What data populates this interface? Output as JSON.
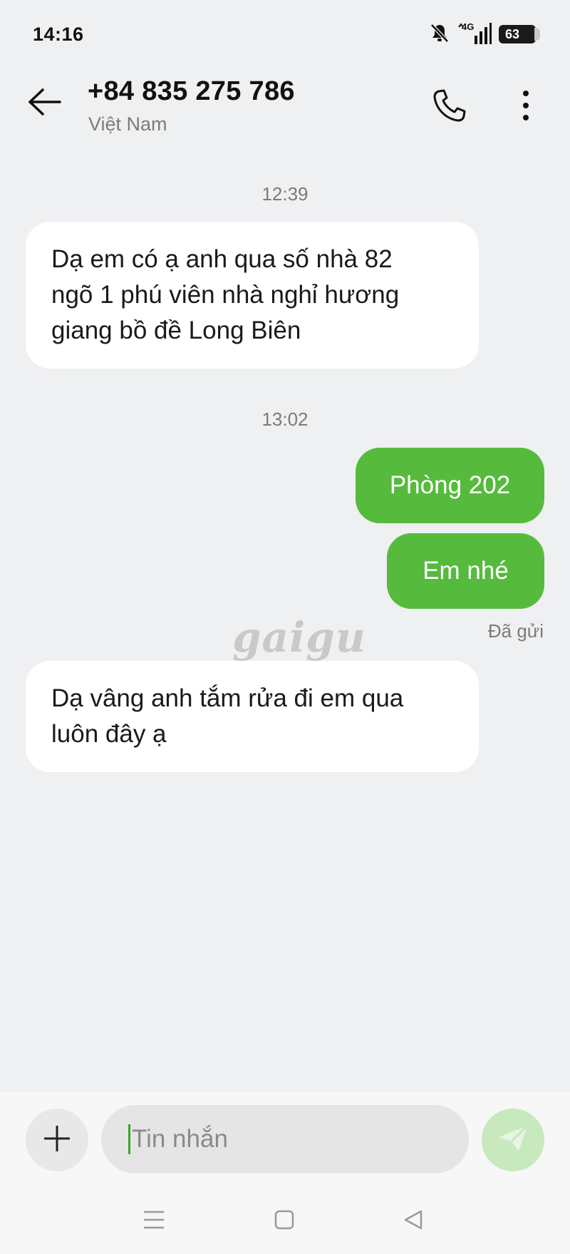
{
  "status_bar": {
    "time": "14:16",
    "network": "4G",
    "battery": "63",
    "icons": [
      "bell-muted-icon",
      "signal-4g-icon",
      "battery-icon"
    ]
  },
  "header": {
    "title": "+84 835 275 786",
    "subtitle": "Việt Nam",
    "icons": [
      "back-arrow-icon",
      "phone-icon",
      "more-vertical-icon"
    ]
  },
  "conversation": {
    "groups": [
      {
        "time": "12:39",
        "messages": [
          {
            "direction": "incoming",
            "lines": [
              "Dạ em có ạ anh qua số nhà 82",
              "ngõ 1 phú viên nhà nghỉ hương",
              "giang bồ đề Long Biên"
            ]
          }
        ]
      },
      {
        "time": "13:02",
        "messages": [
          {
            "direction": "outgoing",
            "text": "Phòng 202"
          },
          {
            "direction": "outgoing",
            "text": "Em nhé",
            "status": "Đã gửi"
          },
          {
            "direction": "incoming",
            "lines": [
              "Dạ vâng anh tắm rửa đi em qua",
              "luôn đây ạ"
            ]
          }
        ]
      }
    ]
  },
  "watermark": "gaigu",
  "composer": {
    "placeholder": "Tin nhắn",
    "value": "",
    "icons": [
      "plus-icon",
      "send-icon"
    ]
  },
  "nav_bar": {
    "icons": [
      "menu-icon",
      "home-square-icon",
      "back-triangle-icon"
    ]
  },
  "colors": {
    "background": "#eff0f2",
    "incoming_bubble": "#ffffff",
    "outgoing_bubble": "#56bb3d",
    "send_button": "#c7e9bd",
    "secondary_text": "#7b7b7b"
  }
}
